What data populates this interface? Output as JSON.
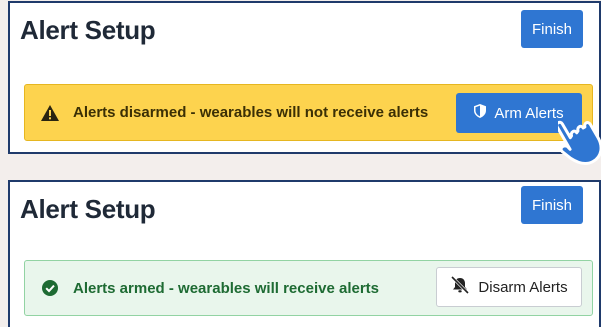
{
  "top_panel": {
    "title": "Alert Setup",
    "finish_label": "Finish",
    "alert": {
      "status": "disarmed",
      "icon": "warning-icon",
      "message": "Alerts disarmed - wearables will not receive alerts",
      "action_icon": "shield-icon",
      "action_label": "Arm Alerts"
    }
  },
  "bottom_panel": {
    "title": "Alert Setup",
    "finish_label": "Finish",
    "alert": {
      "status": "armed",
      "icon": "check-circle-icon",
      "message": "Alerts armed - wearables will receive alerts",
      "action_icon": "bell-off-icon",
      "action_label": "Disarm Alerts"
    }
  },
  "cursor": {
    "icon": "hand-pointer-icon"
  },
  "colors": {
    "primary": "#2f76d2",
    "warning_bg": "#fdd34e",
    "success_bg": "#e9f6ec",
    "success_text": "#1e6b33",
    "panel_border": "#1f3a6b"
  }
}
